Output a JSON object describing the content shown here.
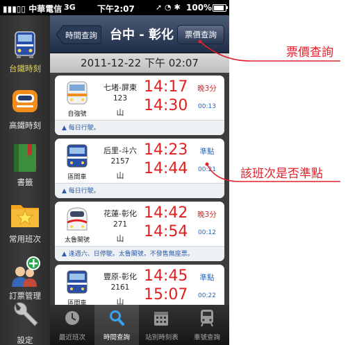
{
  "status_bar": {
    "carrier": "中華電信",
    "network": "3G",
    "time": "下午2:07",
    "icons": "➚ ◔ ✱",
    "battery": "100%"
  },
  "sidebar": {
    "items": [
      {
        "label": "台鐵時刻",
        "icon": "tra-train-icon",
        "active": true
      },
      {
        "label": "高鐵時刻",
        "icon": "thsr-train-icon",
        "active": false
      },
      {
        "label": "書籤",
        "icon": "bookmark-icon",
        "active": false
      },
      {
        "label": "常用班次",
        "icon": "star-folder-icon",
        "active": false
      },
      {
        "label": "訂票管理",
        "icon": "people-add-icon",
        "active": false
      },
      {
        "label": "設定",
        "icon": "wrench-icon",
        "active": false
      }
    ]
  },
  "header": {
    "back_label": "時間查詢",
    "title": "台中 - 彰化",
    "fare_label": "票價查詢"
  },
  "date_bar": "2011-12-22 下午 02:07",
  "trains": [
    {
      "route": "七堵-屏東",
      "number": "123",
      "destination": "山",
      "depart": "14:17",
      "arrive": "14:30",
      "status": "晚3分",
      "duration": "00:13",
      "type": "自強號",
      "note": "▲ 每日行駛。",
      "late": true
    },
    {
      "route": "后里-斗六",
      "number": "2157",
      "destination": "山",
      "depart": "14:23",
      "arrive": "14:44",
      "status": "準點",
      "duration": "00:21",
      "type": "區間車",
      "note": "▲ 每日行駛。",
      "late": false
    },
    {
      "route": "花蓮-彰化",
      "number": "271",
      "destination": "山",
      "depart": "14:42",
      "arrive": "14:54",
      "status": "晚3分",
      "duration": "00:12",
      "type": "太魯閣號",
      "note": "▲ 逢週六、日停駛。太魯閣號，不發售無座票。",
      "late": true
    },
    {
      "route": "豐原-彰化",
      "number": "2161",
      "destination": "山",
      "depart": "14:45",
      "arrive": "15:07",
      "status": "準點",
      "duration": "00:22",
      "type": "區間車",
      "note": "",
      "late": false
    }
  ],
  "tabs": [
    {
      "label": "最近班次",
      "icon": "clock-icon",
      "active": false
    },
    {
      "label": "時間查詢",
      "icon": "magnifier-icon",
      "active": true
    },
    {
      "label": "站別時刻表",
      "icon": "calendar-icon",
      "active": false
    },
    {
      "label": "車號查詢",
      "icon": "train-front-icon",
      "active": false
    }
  ],
  "annotations": {
    "fare_callout": "票價查詢",
    "status_callout": "該班次是否準點"
  },
  "colors": {
    "accent_red": "#e02020",
    "link_blue": "#2463b8",
    "nav_dark": "#1f2d48",
    "sidebar_active": "#e5d44a"
  }
}
